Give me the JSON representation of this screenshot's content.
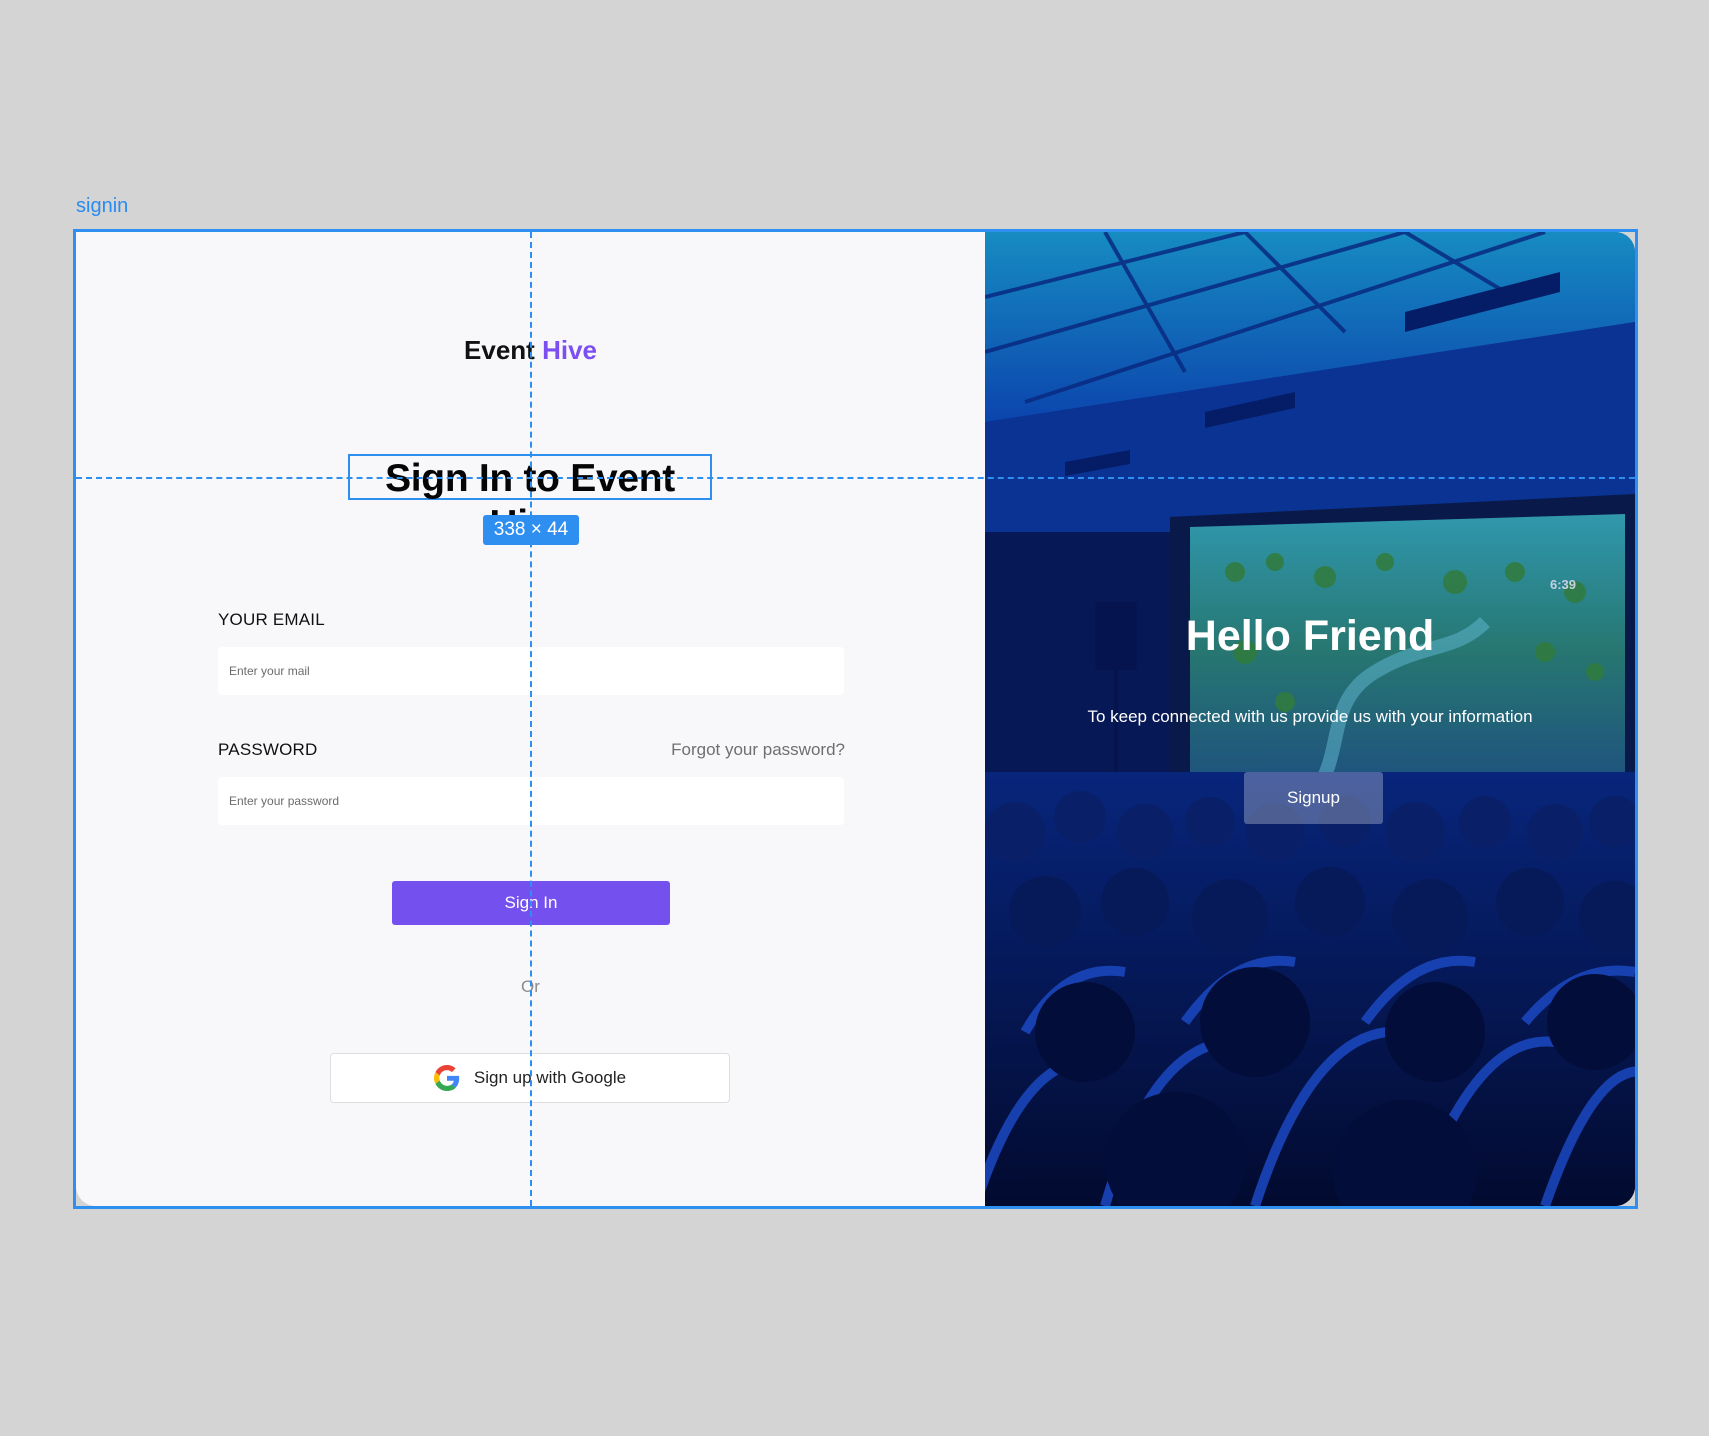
{
  "frame": {
    "label": "signin",
    "selection_size": "338 × 44"
  },
  "brand": {
    "name_part1": "Event",
    "name_part2": "Hive",
    "accent_color": "#7b4ff0"
  },
  "signin": {
    "title": "Sign In to Event Hive",
    "email_label": "YOUR EMAIL",
    "email_placeholder": "Enter your mail",
    "password_label": "PASSWORD",
    "password_placeholder": "Enter your password",
    "forgot_label": "Forgot your password?",
    "submit_label": "Sign In",
    "or_label": "Or",
    "google_label": "Sign up with Google",
    "button_color": "#7450ef"
  },
  "welcome": {
    "title": "Hello Friend",
    "subtitle": "To keep connected with us provide us with your information",
    "signup_label": "Signup",
    "screen_clock": "6:39"
  }
}
